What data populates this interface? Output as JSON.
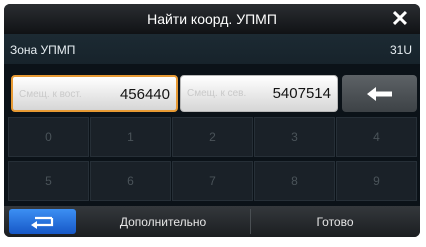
{
  "dialog": {
    "title": "Найти коорд. УПМП"
  },
  "zone": {
    "label": "Зона УПМП",
    "value": "31U"
  },
  "fields": {
    "east": {
      "label": "Смещ. к вост.",
      "value": "456440",
      "active": true
    },
    "north": {
      "label": "Смещ. к сев.",
      "value": "5407514",
      "active": false
    }
  },
  "keypad": {
    "row1": [
      "0",
      "1",
      "2",
      "3",
      "4"
    ],
    "row2": [
      "5",
      "6",
      "7",
      "8",
      "9"
    ]
  },
  "bottombar": {
    "back_icon": "undo-arrow-icon",
    "more_label": "Дополнительно",
    "done_label": "Готово"
  },
  "colors": {
    "accent_active_border": "#e79a34",
    "back_button": "#2f79e6"
  }
}
